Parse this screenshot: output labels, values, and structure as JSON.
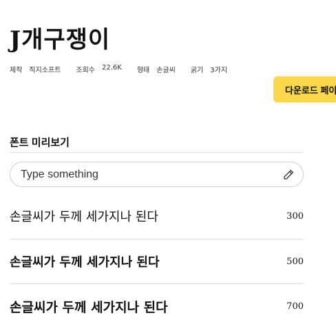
{
  "font": {
    "name": "J개구쟁이"
  },
  "meta": [
    {
      "label": "제작",
      "value": "직지소프트"
    },
    {
      "label": "조회수",
      "value": "22.6K"
    },
    {
      "label": "형태",
      "value": "손글씨"
    },
    {
      "label": "굵기",
      "value": "3가지"
    }
  ],
  "download": {
    "label": "다운로드 페이"
  },
  "preview": {
    "section_title": "폰트 미리보기",
    "input_placeholder": "Type something",
    "icon": "pencil-icon",
    "rows": [
      {
        "text": "손글씨가 두께 세가지나 된다",
        "weight": "300"
      },
      {
        "text": "손글씨가 두께 세가지나 된다",
        "weight": "500"
      },
      {
        "text": "손글씨가 두께 세가지나 된다",
        "weight": "700"
      }
    ]
  },
  "colors": {
    "accent": "#fbd84a",
    "divider": "#dddddd",
    "text": "#111111"
  }
}
